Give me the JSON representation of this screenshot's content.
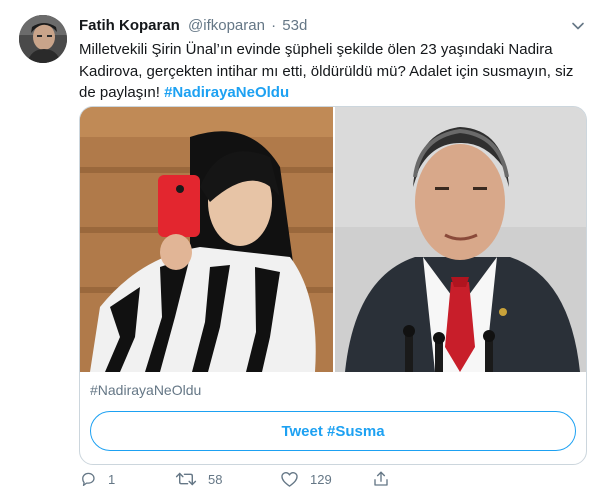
{
  "tweet": {
    "author_name": "Fatih Koparan",
    "handle": "@ifkoparan",
    "separator": "·",
    "time": "53d",
    "text_plain": "Milletvekili Şirin Ünal’ın evinde şüpheli şekilde ölen 23 yaşındaki Nadira Kadirova, gerçekten intihar mı etti, öldürüldü mü? Adalet için susmayın, siz de paylaşın! ",
    "text_hashtag": "#NadirayaNeOldu"
  },
  "card": {
    "tag": "#NadirayaNeOldu",
    "button_label": "Tweet #Susma"
  },
  "actions": {
    "replies": "1",
    "retweets": "58",
    "likes": "129"
  },
  "icons": {
    "caret": "chevron-down-icon",
    "reply": "reply-icon",
    "retweet": "retweet-icon",
    "like": "heart-icon",
    "share": "share-icon"
  },
  "colors": {
    "accent": "#1da1f2",
    "secondary_text": "#657786",
    "border": "#ccd6dd"
  }
}
